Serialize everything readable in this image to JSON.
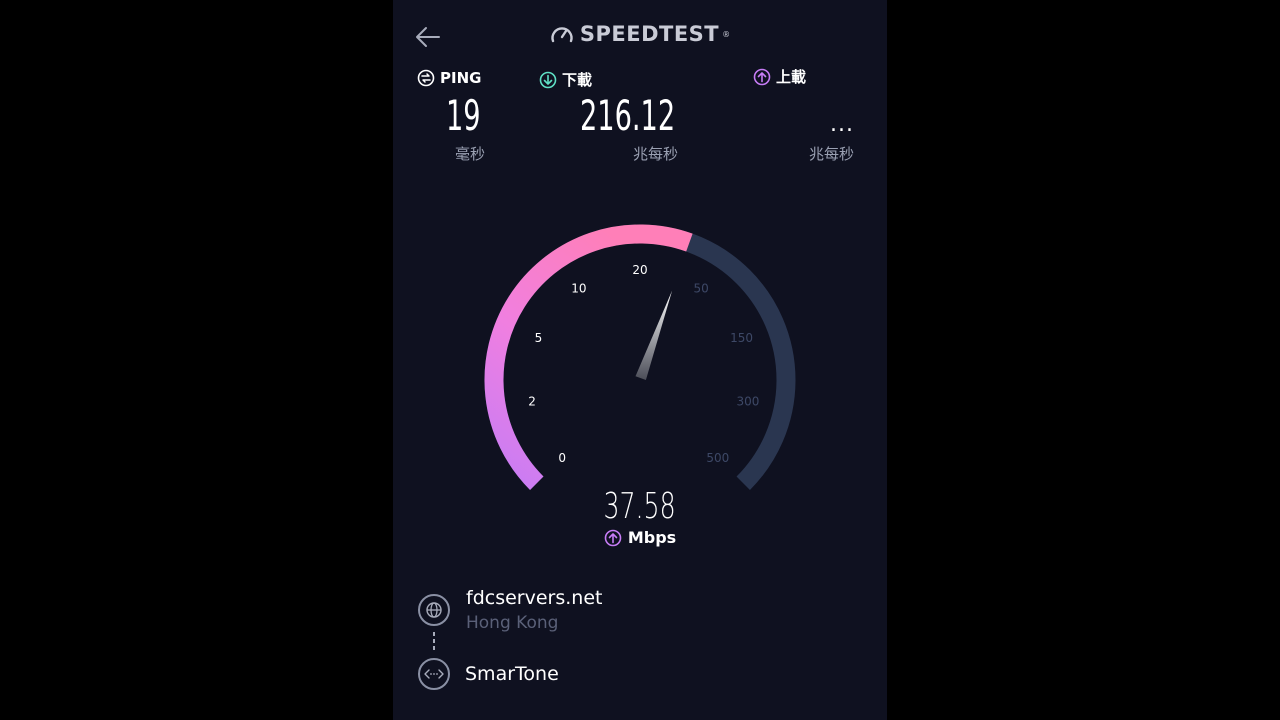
{
  "header": {
    "brand": "SPEEDTEST",
    "brand_mark": "®",
    "back_icon": "back-arrow-icon",
    "logo_icon": "speedometer-icon"
  },
  "metrics": {
    "ping": {
      "label": "PING",
      "value": "19",
      "unit": "毫秒",
      "icon": "ping-icon"
    },
    "download": {
      "label": "下載",
      "value": "216.12",
      "unit": "兆每秒",
      "icon": "download-arrow-icon"
    },
    "upload": {
      "label": "上載",
      "value": "...",
      "unit": "兆每秒",
      "icon": "upload-arrow-icon"
    }
  },
  "gauge": {
    "ticks": [
      "0",
      "2",
      "5",
      "10",
      "20",
      "50",
      "150",
      "300",
      "500"
    ],
    "current_value": "37.58",
    "current_unit": "Mbps",
    "needle_value": 37.58,
    "colors": {
      "arc_start": "#c67cf5",
      "arc_end": "#ff7fb8",
      "track": "#2a3650",
      "active_tick": "#ffffff",
      "inactive_tick": "#3d4866"
    }
  },
  "server": {
    "host": "fdcservers.net",
    "location": "Hong Kong",
    "host_icon": "globe-icon"
  },
  "isp": {
    "name": "SmarTone",
    "icon": "connection-icon"
  }
}
